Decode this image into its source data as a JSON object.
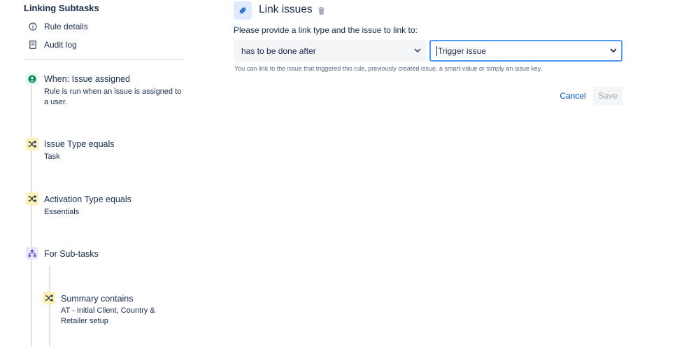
{
  "sidebar": {
    "rule_title": "Linking Subtasks",
    "nav": [
      {
        "label": "Rule details",
        "icon": "info-icon"
      },
      {
        "label": "Audit log",
        "icon": "document-icon"
      }
    ],
    "components": [
      {
        "title": "When: Issue assigned",
        "desc_line1": "Rule is run when an issue is assigned to",
        "desc_line2": "a user.",
        "icon": "trigger-icon"
      },
      {
        "title": "Issue Type equals",
        "desc_line1": "Task",
        "icon": "shuffle-icon"
      },
      {
        "title": "Activation Type equals",
        "desc_line1": "Essentials",
        "icon": "shuffle-icon"
      },
      {
        "title": "For Sub-tasks",
        "icon": "branch-icon"
      },
      {
        "title": "Summary contains",
        "desc_line1": "AT - Initial Client, Country &",
        "desc_line2": "Retailer setup",
        "icon": "shuffle-icon"
      }
    ]
  },
  "main": {
    "title": "Link issues",
    "header_icon": "link-icon",
    "prompt": "Please provide a link type and the issue to link to:",
    "link_type_value": "has to be done after",
    "issue_value": "Trigger issue",
    "helper_text": "You can link to the issue that triggered this rule, previously created issue, a smart-value or simply an issue key.",
    "cancel_label": "Cancel",
    "save_label": "Save"
  },
  "colors": {
    "accent": "#0052cc",
    "focus_border": "#4c9aff",
    "trigger_bg": "#e3fcef",
    "trigger_fg": "#00875a",
    "condition_bg": "#fff0b3",
    "branch_bg": "#eae6ff",
    "branch_fg": "#6554c0"
  }
}
